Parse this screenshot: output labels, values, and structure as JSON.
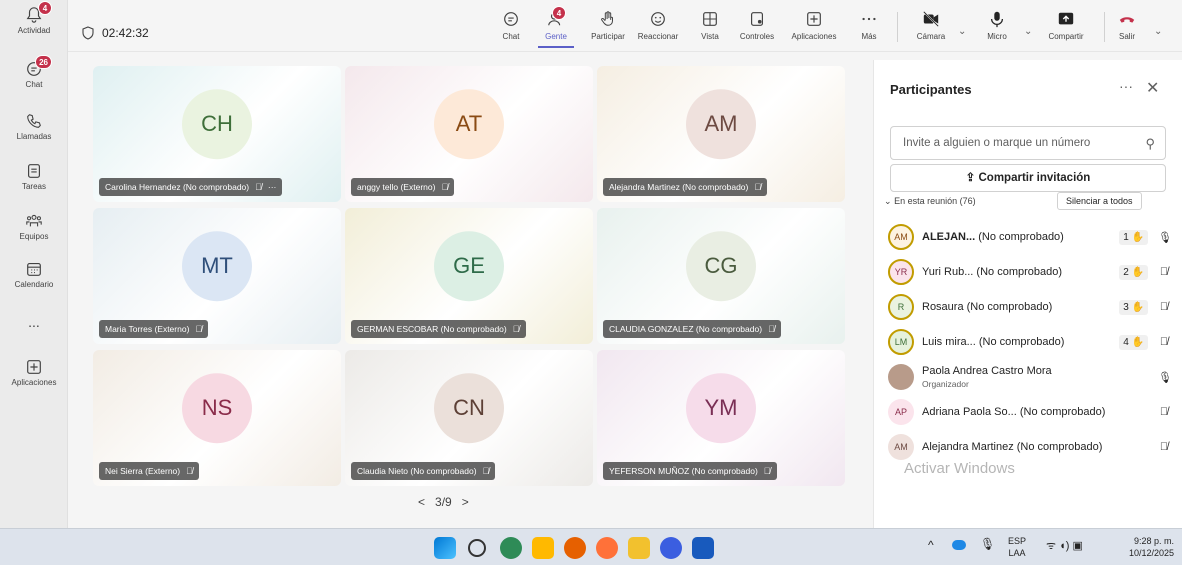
{
  "rail": {
    "items": [
      {
        "label": "Actividad",
        "badge": "4"
      },
      {
        "label": "Chat",
        "badge": "26"
      },
      {
        "label": "Llamadas"
      },
      {
        "label": "Tareas"
      },
      {
        "label": "Equipos"
      },
      {
        "label": "Calendario"
      },
      {
        "label": "..."
      },
      {
        "label": "Aplicaciones"
      }
    ]
  },
  "topbar": {
    "timer": "02:42:32",
    "people_badge": "4",
    "buttons": [
      "Chat",
      "Gente",
      "Participar",
      "Reaccionar",
      "Vista",
      "Controles",
      "Aplicaciones",
      "Más"
    ],
    "media": [
      "Cámara",
      "Micro",
      "Compartir",
      "Salir"
    ]
  },
  "tiles": [
    {
      "initials": "CH",
      "name": "Carolina Hernandez (No comprobado)",
      "more": "···",
      "bg": "#dff0f1",
      "av": "#eaf3e0",
      "fg": "#3f6f3a"
    },
    {
      "initials": "AT",
      "name": "anggy tello (Externo)",
      "bg": "#f4e8ec",
      "av": "#fde9d8",
      "fg": "#8a4b14"
    },
    {
      "initials": "AM",
      "name": "Alejandra Martinez (No comprobado)",
      "bg": "#f5eee2",
      "av": "#efe1dd",
      "fg": "#6d4a42"
    },
    {
      "initials": "MT",
      "name": "Maria Torres (Externo)",
      "bg": "#e6eef2",
      "av": "#dbe6f4",
      "fg": "#2f4f7a"
    },
    {
      "initials": "GE",
      "name": "GERMAN ESCOBAR (No comprobado)",
      "bg": "#f2eed8",
      "av": "#dcefe4",
      "fg": "#2e6b49"
    },
    {
      "initials": "CG",
      "name": "CLAUDIA GONZALEZ (No comprobado)",
      "bg": "#e8f1ee",
      "av": "#e9eee3",
      "fg": "#4a5b3e"
    },
    {
      "initials": "NS",
      "name": "Nei Sierra (Externo)",
      "bg": "#f2ece4",
      "av": "#f7d9e2",
      "fg": "#8a2c4a"
    },
    {
      "initials": "CN",
      "name": "Claudia Nieto (No comprobado)",
      "bg": "#eceae7",
      "av": "#ebe0da",
      "fg": "#5d4036"
    },
    {
      "initials": "YM",
      "name": "YEFERSON MUÑOZ (No comprobado)",
      "bg": "#f1e7f0",
      "av": "#f6dcea",
      "fg": "#7a2f55"
    }
  ],
  "pager": {
    "prev": "<",
    "label": "3/9",
    "next": ">"
  },
  "panel": {
    "title": "Participantes",
    "more": "···",
    "close": "✕",
    "search_placeholder": "Invite a alguien o marque un número",
    "share_label": "Compartir invitación",
    "section": "En esta reunión (76)",
    "mute_all": "Silenciar a todos",
    "participants": [
      {
        "initials": "AM",
        "name_bold": "ALEJAN...",
        "name_rest": " (No comprobado)",
        "hand": "1",
        "mic": "on"
      },
      {
        "initials": "YR",
        "name_bold": "",
        "name_rest": "Yuri Rub... (No comprobado)",
        "hand": "2",
        "mic": "off"
      },
      {
        "initials": "R",
        "name_bold": "",
        "name_rest": "Rosaura (No comprobado)",
        "hand": "3",
        "mic": "off"
      },
      {
        "initials": "LM",
        "name_bold": "",
        "name_rest": "Luis mira... (No comprobado)",
        "hand": "4",
        "mic": "off"
      },
      {
        "initials": "",
        "name_bold": "",
        "name_rest": "Paola Andrea Castro Mora",
        "sub": "Organizador",
        "hand": "",
        "mic": "on"
      },
      {
        "initials": "AP",
        "name_bold": "",
        "name_rest": "Adriana Paola So... (No comprobado)",
        "hand": "",
        "mic": "off"
      },
      {
        "initials": "AM",
        "name_bold": "",
        "name_rest": "Alejandra Martinez (No comprobado)",
        "hand": "",
        "mic": "off"
      }
    ],
    "watermark": "Activar Windows"
  },
  "taskbar": {
    "lang_top": "ESP",
    "lang_bottom": "LAA",
    "time": "9:28 p. m.",
    "date": "10/12/2025"
  }
}
